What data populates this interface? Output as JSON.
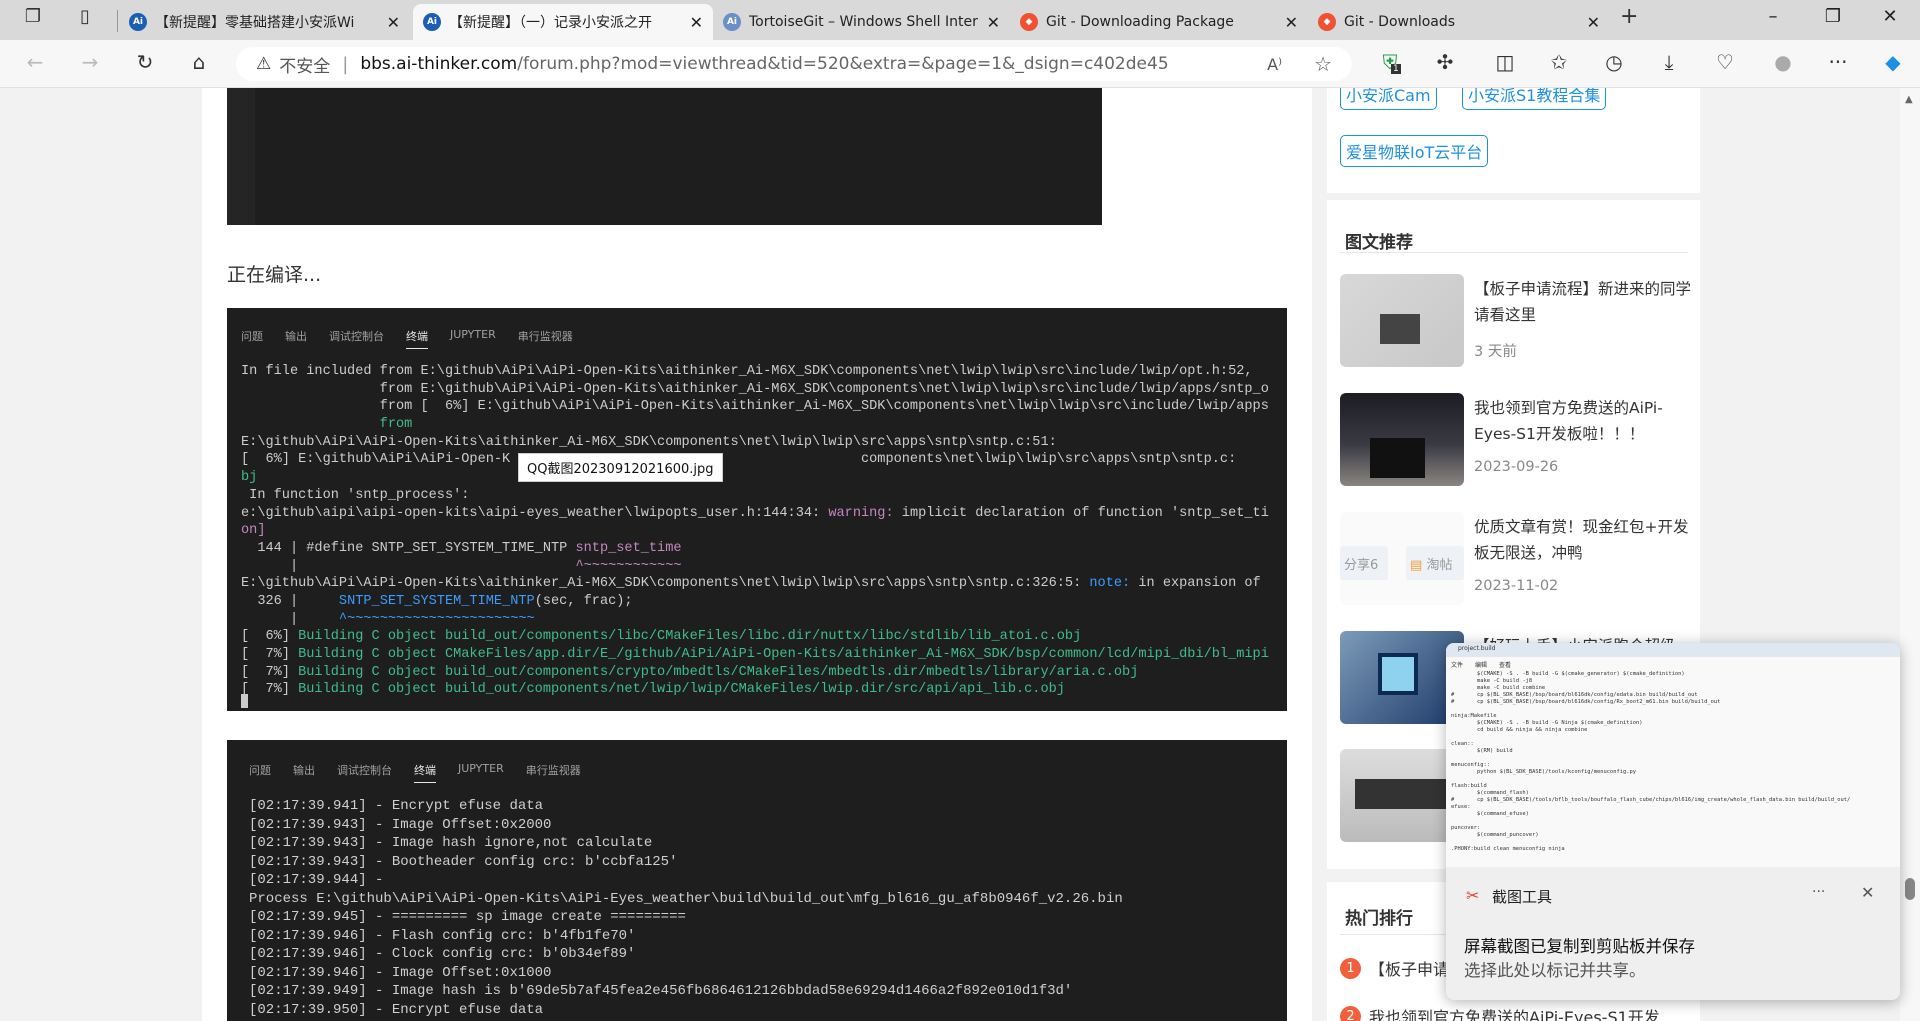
{
  "browser": {
    "tabs": [
      {
        "title": "【新提醒】零基础搭建小安派Wi",
        "favicon": "ai-thinker-icon",
        "color": "#1a5fb4",
        "active": false
      },
      {
        "title": "【新提醒】（一）记录小安派之开",
        "favicon": "ai-thinker-icon",
        "color": "#1a5fb4",
        "active": true
      },
      {
        "title": "TortoiseGit – Windows Shell Inter",
        "favicon": "tortoisegit-icon",
        "color": "#6b8fc7",
        "active": false
      },
      {
        "title": "Git - Downloading Package",
        "favicon": "git-icon",
        "color": "#f05133",
        "active": false
      },
      {
        "title": "Git - Downloads",
        "favicon": "git-icon",
        "color": "#f05133",
        "active": false
      }
    ],
    "security_label": "不安全",
    "url_domain": "bbs.ai-thinker.com",
    "url_path": "/forum.php?mod=viewthread&tid=520&extra=&page=1&_dsign=c402de45",
    "extension_badge": "1"
  },
  "article": {
    "compiling_text": "正在编译...",
    "terminal_tabs": [
      "问题",
      "输出",
      "调试控制台",
      "终端",
      "JUPYTER",
      "串行监视器"
    ],
    "active_terminal_tab": "终端",
    "tooltip": "QQ截图20230912021600.jpg",
    "colors": {
      "default": "#cccccc",
      "green": "#3dbd8c",
      "purple": "#c586c0",
      "blue": "#3b9cff"
    },
    "terminal1": [
      [
        [
          "In file included from E:\\github\\AiPi\\AiPi-Open-Kits\\aithinker_Ai-M6X_SDK\\components\\net\\lwip\\lwip\\src\\include/lwip/opt.h:52,",
          "default"
        ]
      ],
      [
        [
          "                 from E:\\github\\AiPi\\AiPi-Open-Kits\\aithinker_Ai-M6X_SDK\\components\\net\\lwip\\lwip\\src\\include/lwip/apps/sntp_o",
          "default"
        ]
      ],
      [
        [
          "                 from [  6%] E:\\github\\AiPi\\AiPi-Open-Kits\\aithinker_Ai-M6X_SDK\\components\\net\\lwip\\lwip\\src\\include/lwip/apps",
          "default"
        ]
      ],
      [
        [
          "                 from",
          "green"
        ]
      ],
      [
        [
          "E:\\github\\AiPi\\AiPi-Open-Kits\\aithinker_Ai-M6X_SDK\\components\\net\\lwip\\lwip\\src\\apps\\sntp\\sntp.c:51:",
          "default"
        ]
      ],
      [
        [
          "[  6%] E:\\github\\AiPi\\AiPi-Open-K",
          "default"
        ],
        [
          "                                           components\\net\\lwip\\lwip\\src\\apps\\sntp\\sntp.c:",
          "default"
        ]
      ],
      [
        [
          "bj",
          "green"
        ]
      ],
      [
        [
          " In function 'sntp_process':",
          "default"
        ]
      ],
      [
        [
          "e:\\github\\aipi\\aipi-open-kits\\aipi-eyes_weather\\lwipopts_user.h:144:34: ",
          "default"
        ],
        [
          "warning:",
          "purple"
        ],
        [
          " implicit declaration of function 'sntp_set_ti",
          "default"
        ]
      ],
      [
        [
          "on]",
          "purple"
        ]
      ],
      [
        [
          "  144 | #define SNTP_SET_SYSTEM_TIME_NTP ",
          "default"
        ],
        [
          "sntp_set_time",
          "purple"
        ]
      ],
      [
        [
          "      |                                  ",
          "default"
        ],
        [
          "^~~~~~~~~~~~~",
          "purple"
        ]
      ],
      [
        [
          "E:\\github\\AiPi\\AiPi-Open-Kits\\aithinker_Ai-M6X_SDK\\components\\net\\lwip\\lwip\\src\\apps\\sntp\\sntp.c:326:5: ",
          "default"
        ],
        [
          "note:",
          "blue"
        ],
        [
          " in expansion of",
          "default"
        ]
      ],
      [
        [
          "  326 |     ",
          "default"
        ],
        [
          "SNTP_SET_SYSTEM_TIME_NTP",
          "blue"
        ],
        [
          "(sec, frac);",
          "default"
        ]
      ],
      [
        [
          "      |     ",
          "default"
        ],
        [
          "^~~~~~~~~~~~~~~~~~~~~~~~",
          "blue"
        ]
      ],
      [
        [
          "[  6%] ",
          "default"
        ],
        [
          "Building C object build_out/components/libc/CMakeFiles/libc.dir/nuttx/libc/stdlib/lib_atoi.c.obj",
          "green"
        ]
      ],
      [
        [
          "[  7%] ",
          "default"
        ],
        [
          "Building C object CMakeFiles/app.dir/E_/github/AiPi/AiPi-Open-Kits/aithinker_Ai-M6X_SDK/bsp/common/lcd/mipi_dbi/bl_mipi",
          "green"
        ]
      ],
      [
        [
          "[  7%] ",
          "default"
        ],
        [
          "Building C object build_out/components/crypto/mbedtls/CMakeFiles/mbedtls.dir/mbedtls/library/aria.c.obj",
          "green"
        ]
      ],
      [
        [
          "[  7%] ",
          "default"
        ],
        [
          "Building C object build_out/components/net/lwip/lwip/CMakeFiles/lwip.dir/src/api/api_lib.c.obj",
          "green"
        ]
      ]
    ],
    "terminal2": [
      "[02:17:39.941] - Encrypt efuse data",
      "[02:17:39.943] - Image Offset:0x2000",
      "[02:17:39.943] - Image hash ignore,not calculate",
      "[02:17:39.943] - Bootheader config crc: b'ccbfa125'",
      "[02:17:39.944] -",
      "Process E:\\github\\AiPi\\AiPi-Open-Kits\\AiPi-Eyes_weather\\build\\build_out\\mfg_bl616_gu_af8b0946f_v2.26.bin",
      "[02:17:39.945] - ========= sp image create =========",
      "[02:17:39.946] - Flash config crc: b'4fb1fe70'",
      "[02:17:39.946] - Clock config crc: b'0b34ef89'",
      "[02:17:39.946] - Image Offset:0x1000",
      "[02:17:39.949] - Image hash is b'69de5b7af45fea2e456fb6864612126bbdad58e69294d1466a2f892e010d1f3d'",
      "[02:17:39.950] - Encrypt efuse data"
    ]
  },
  "sidebar": {
    "tags": [
      "小安派Cam",
      "小安派S1教程合集",
      "爱星物联IoT云平台"
    ],
    "recommend_title": "图文推荐",
    "recommend": [
      {
        "title": "【板子申请流程】新进来的同学请看这里",
        "date": "3 天前"
      },
      {
        "title": "我也领到官方免费送的AiPi-Eyes-S1开发板啦！！！",
        "date": "2023-09-26"
      },
      {
        "title": "优质文章有赏！现金红包+开发板无限送，冲鸭",
        "date": "2023-11-02",
        "thumb_text": [
          "分享6",
          "淘帖"
        ]
      },
      {
        "title": "【好玩上手】小安派跑个超级",
        "date": ""
      },
      {
        "title": "",
        "date": ""
      }
    ],
    "hot_title": "热门排行",
    "hot": [
      {
        "rank": "1",
        "title": "【板子申请"
      },
      {
        "rank": "2",
        "title": "我也领到官方免费送的AiPi-Eyes-S1开发"
      }
    ],
    "accent": "#1e90e0"
  },
  "notification": {
    "app": "截图工具",
    "message": "屏幕截图已复制到剪贴板并保存",
    "hint": "选择此处以标记并共享。",
    "more": "···",
    "preview": {
      "tab": "project.build",
      "menu": [
        "文件",
        "编辑",
        "查看"
      ],
      "text": "        $(CMAKE) -S . -B build -G $(cmake_generator) $(cmake_definition)\n        make -C build -j8\n        make -C build combine\n#       cp $(BL_SDK_BASE)/bsp/board/bl616dk/config/edata.bin build/build_out\n#       cp $(BL_SDK_BASE)/bsp/board/bl616dk/config/Rx_boot2_m61.bin build/build_out\n\nninja:Makefile\n        $(CMAKE) -S . -B build -G Ninja $(cmake_definition)\n        cd build && ninja && ninja combine\n\nclean::\n        $(RM) build\n\nmenuconfig::\n        python $(BL_SDK_BASE)/tools/kconfig/menuconfig.py\n\nflash:build\n        $(command_flash)\n#       cp $(BL_SDK_BASE)/tools/bflb_tools/bouffalo_flash_cube/chips/bl616/img_create/whole_flash_data.bin build/build_out/\nefuse:\n        $(command_efuse)\n\npuncover:\n        $(command_puncover)\n\n.PHONY:build clean menuconfig ninja"
    }
  }
}
